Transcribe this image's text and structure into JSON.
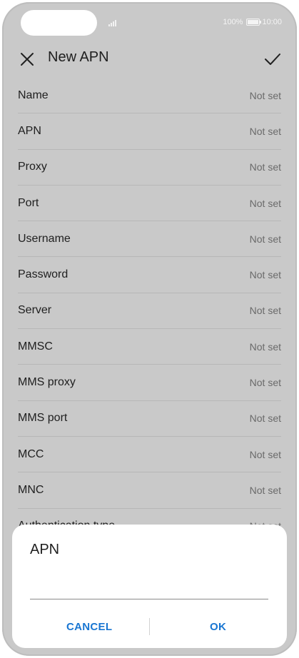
{
  "status_bar": {
    "battery": "100%",
    "time": "10:00"
  },
  "appbar": {
    "title": "New APN"
  },
  "fields": [
    {
      "label": "Name",
      "value": "Not set"
    },
    {
      "label": "APN",
      "value": "Not set"
    },
    {
      "label": "Proxy",
      "value": "Not set"
    },
    {
      "label": "Port",
      "value": "Not set"
    },
    {
      "label": "Username",
      "value": "Not set"
    },
    {
      "label": "Password",
      "value": "Not set"
    },
    {
      "label": "Server",
      "value": "Not set"
    },
    {
      "label": "MMSC",
      "value": "Not set"
    },
    {
      "label": "MMS proxy",
      "value": "Not set"
    },
    {
      "label": "MMS port",
      "value": "Not set"
    },
    {
      "label": "MCC",
      "value": "Not set"
    },
    {
      "label": "MNC",
      "value": "Not set"
    },
    {
      "label": "Authentication type",
      "value": "Not set"
    }
  ],
  "dialog": {
    "title": "APN",
    "input_value": "",
    "cancel_label": "CANCEL",
    "ok_label": "OK"
  },
  "colors": {
    "background": "#c9c9c9",
    "accent": "#1976d2"
  }
}
